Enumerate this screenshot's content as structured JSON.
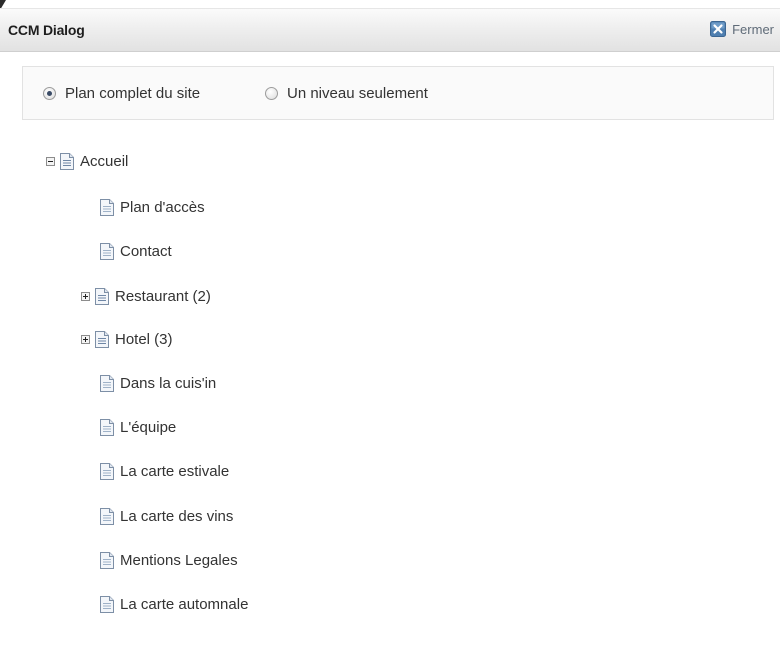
{
  "dialog": {
    "title": "CCM Dialog",
    "close_label": "Fermer"
  },
  "options": {
    "full_sitemap": {
      "label": "Plan complet du site",
      "checked": true
    },
    "one_level": {
      "label": "Un niveau seulement",
      "checked": false
    }
  },
  "tree": {
    "root": {
      "label": "Accueil",
      "expanded": true,
      "icon": "page-icon"
    },
    "children": [
      {
        "label": "Plan d'accès",
        "expandable": false
      },
      {
        "label": "Contact",
        "expandable": false
      },
      {
        "label": "Restaurant (2)",
        "expandable": true,
        "expanded": false
      },
      {
        "label": "Hotel (3)",
        "expandable": true,
        "expanded": false
      },
      {
        "label": "Dans la cuis'in",
        "expandable": false
      },
      {
        "label": "L'équipe",
        "expandable": false
      },
      {
        "label": "La carte estivale",
        "expandable": false
      },
      {
        "label": "La carte des vins",
        "expandable": false
      },
      {
        "label": "Mentions Legales",
        "expandable": false
      },
      {
        "label": "La carte automnale",
        "expandable": false
      }
    ]
  },
  "colors": {
    "close_icon": "#4f7fb0",
    "radio_dot": "#3a4b66",
    "page_icon_border": "#7d8fa6"
  }
}
